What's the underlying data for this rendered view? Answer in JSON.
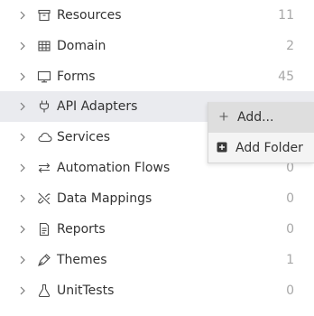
{
  "tree": {
    "items": [
      {
        "label": "Resources",
        "count": "11",
        "icon": "archive-box-icon"
      },
      {
        "label": "Domain",
        "count": "2",
        "icon": "table-grid-icon"
      },
      {
        "label": "Forms",
        "count": "45",
        "icon": "monitor-icon"
      },
      {
        "label": "API Adapters",
        "count": "",
        "icon": "plug-icon"
      },
      {
        "label": "Services",
        "count": "",
        "icon": "cloud-icon"
      },
      {
        "label": "Automation Flows",
        "count": "0",
        "icon": "arrows-exchange-icon"
      },
      {
        "label": "Data Mappings",
        "count": "0",
        "icon": "link-off-icon"
      },
      {
        "label": "Reports",
        "count": "0",
        "icon": "document-icon"
      },
      {
        "label": "Themes",
        "count": "1",
        "icon": "pen-nib-icon"
      },
      {
        "label": "UnitTests",
        "count": "0",
        "icon": "flask-icon"
      }
    ]
  },
  "context_menu": {
    "items": [
      {
        "label": "Add...",
        "icon": "plus-icon"
      },
      {
        "label": "Add Folder",
        "icon": "plus-square-icon"
      }
    ]
  },
  "colors": {
    "highlight_row": "#eaebef",
    "menu_background": "#f4f4f4",
    "menu_active": "#dedede",
    "text": "#333333",
    "count_text": "#a8a8a8"
  }
}
